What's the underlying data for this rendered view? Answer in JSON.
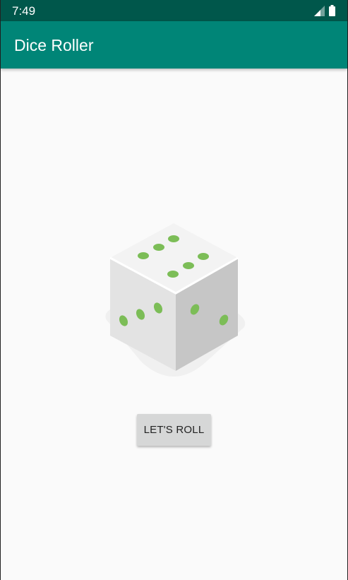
{
  "status_bar": {
    "time": "7:49",
    "signal_icon": "signal-icon",
    "battery_icon": "battery-icon"
  },
  "app_bar": {
    "title": "Dice Roller"
  },
  "dice": {
    "icon": "dice-icon",
    "top_face_value": 6,
    "left_face_value": 3,
    "right_face_value": 2
  },
  "roll_button": {
    "label": "LET'S ROLL"
  },
  "colors": {
    "status_bar": "#00574b",
    "app_bar": "#008577",
    "background": "#fafafa",
    "pip": "#7cbd57",
    "button": "#d6d7d7"
  }
}
